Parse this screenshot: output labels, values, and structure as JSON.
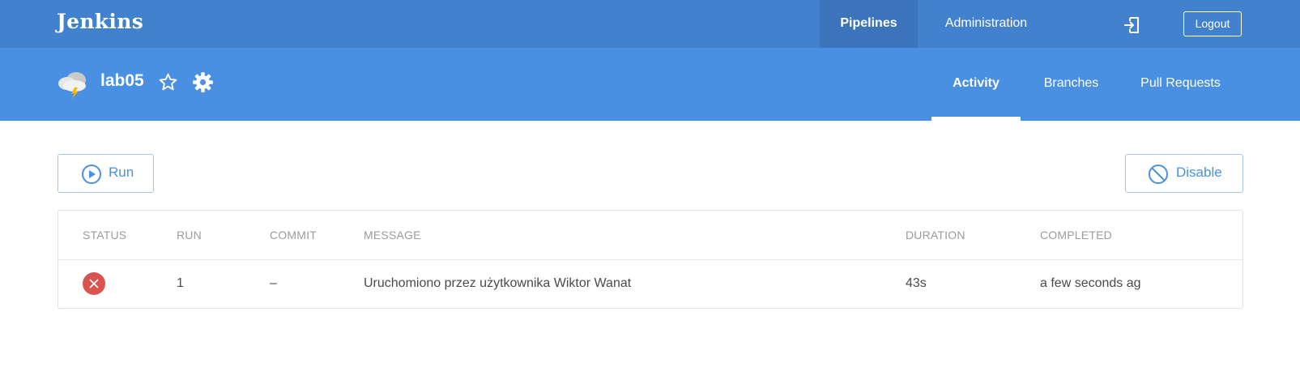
{
  "header": {
    "logo": "Jenkins",
    "nav": [
      {
        "label": "Pipelines",
        "active": true
      },
      {
        "label": "Administration",
        "active": false
      }
    ],
    "exit_icon": "exit-icon",
    "logout_label": "Logout",
    "background_color": "#4281ce"
  },
  "pipeline": {
    "name": "lab05",
    "weather_icon": "weather-stormy-icon",
    "favorite_icon": "star-outline-icon",
    "settings_icon": "gear-icon",
    "tabs": [
      {
        "label": "Activity",
        "active": true
      },
      {
        "label": "Branches",
        "active": false
      },
      {
        "label": "Pull Requests",
        "active": false
      }
    ],
    "background_color": "#4a90e2"
  },
  "actions": {
    "run_label": "Run",
    "disable_label": "Disable"
  },
  "table": {
    "columns": [
      "STATUS",
      "RUN",
      "COMMIT",
      "MESSAGE",
      "DURATION",
      "COMPLETED"
    ],
    "rows": [
      {
        "status": "failed",
        "status_icon": "error-circle-icon",
        "status_color": "#d9534f",
        "run": "1",
        "commit": "–",
        "message": "Uruchomiono przez użytkownika Wiktor Wanat",
        "duration": "43s",
        "completed": "a few seconds ago"
      }
    ]
  }
}
